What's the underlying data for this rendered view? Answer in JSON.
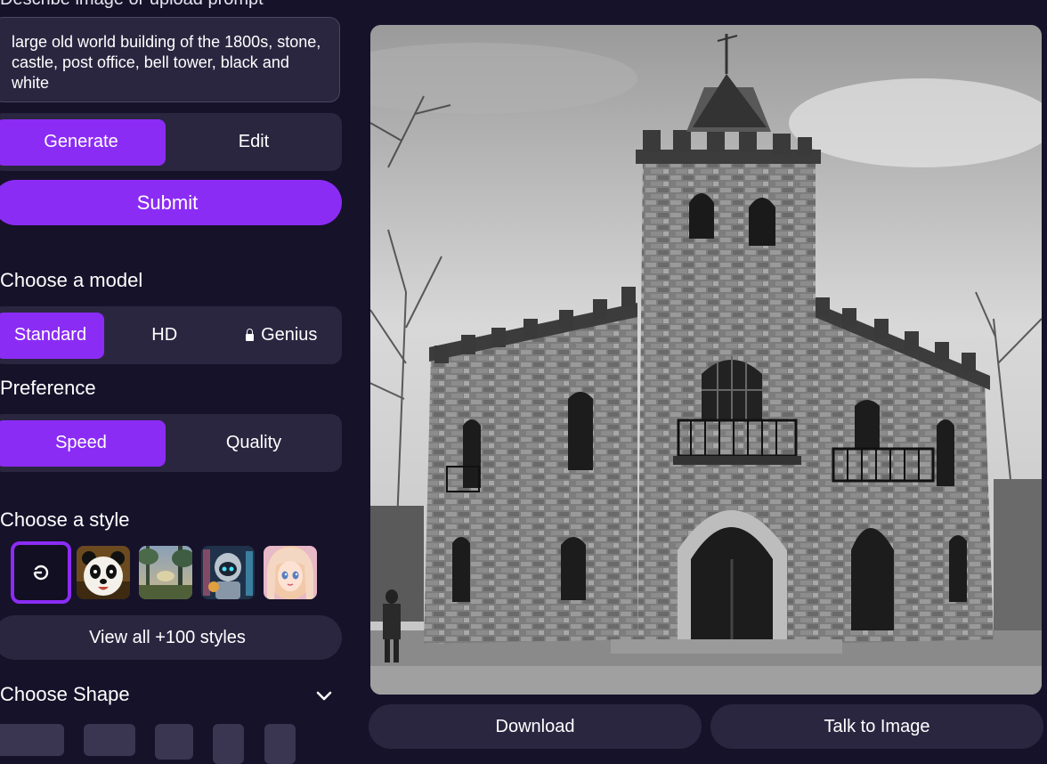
{
  "prompt": {
    "header_cut_text": "Describe image or upload prompt",
    "text": "large old world building of the 1800s, stone, castle, post office, bell tower, black and white"
  },
  "mode_tabs": [
    {
      "label": "Generate",
      "active": true
    },
    {
      "label": "Edit",
      "active": false
    }
  ],
  "submit_label": "Submit",
  "model": {
    "label": "Choose a model",
    "options": [
      {
        "label": "Standard",
        "active": true
      },
      {
        "label": "HD",
        "active": false
      },
      {
        "label": "Genius",
        "active": false,
        "locked": true
      }
    ]
  },
  "preference": {
    "label": "Preference",
    "options": [
      {
        "label": "Speed",
        "active": true
      },
      {
        "label": "Quality",
        "active": false
      }
    ]
  },
  "style": {
    "label": "Choose a style",
    "thumbnails": [
      {
        "name": "no-style",
        "icon": "ban-icon",
        "selected": true
      },
      {
        "name": "panda"
      },
      {
        "name": "forest-landscape"
      },
      {
        "name": "robot"
      },
      {
        "name": "anime-girl"
      }
    ],
    "view_all_label": "View all +100 styles"
  },
  "shape": {
    "label": "Choose Shape",
    "icon": "chevron-down-icon"
  },
  "image": {
    "description": "black and white stone castle with bell tower"
  },
  "actions": {
    "download_label": "Download",
    "talk_label": "Talk to Image"
  },
  "colors": {
    "background": "#16122a",
    "panel": "#2b2640",
    "accent": "#8b2cf5"
  }
}
